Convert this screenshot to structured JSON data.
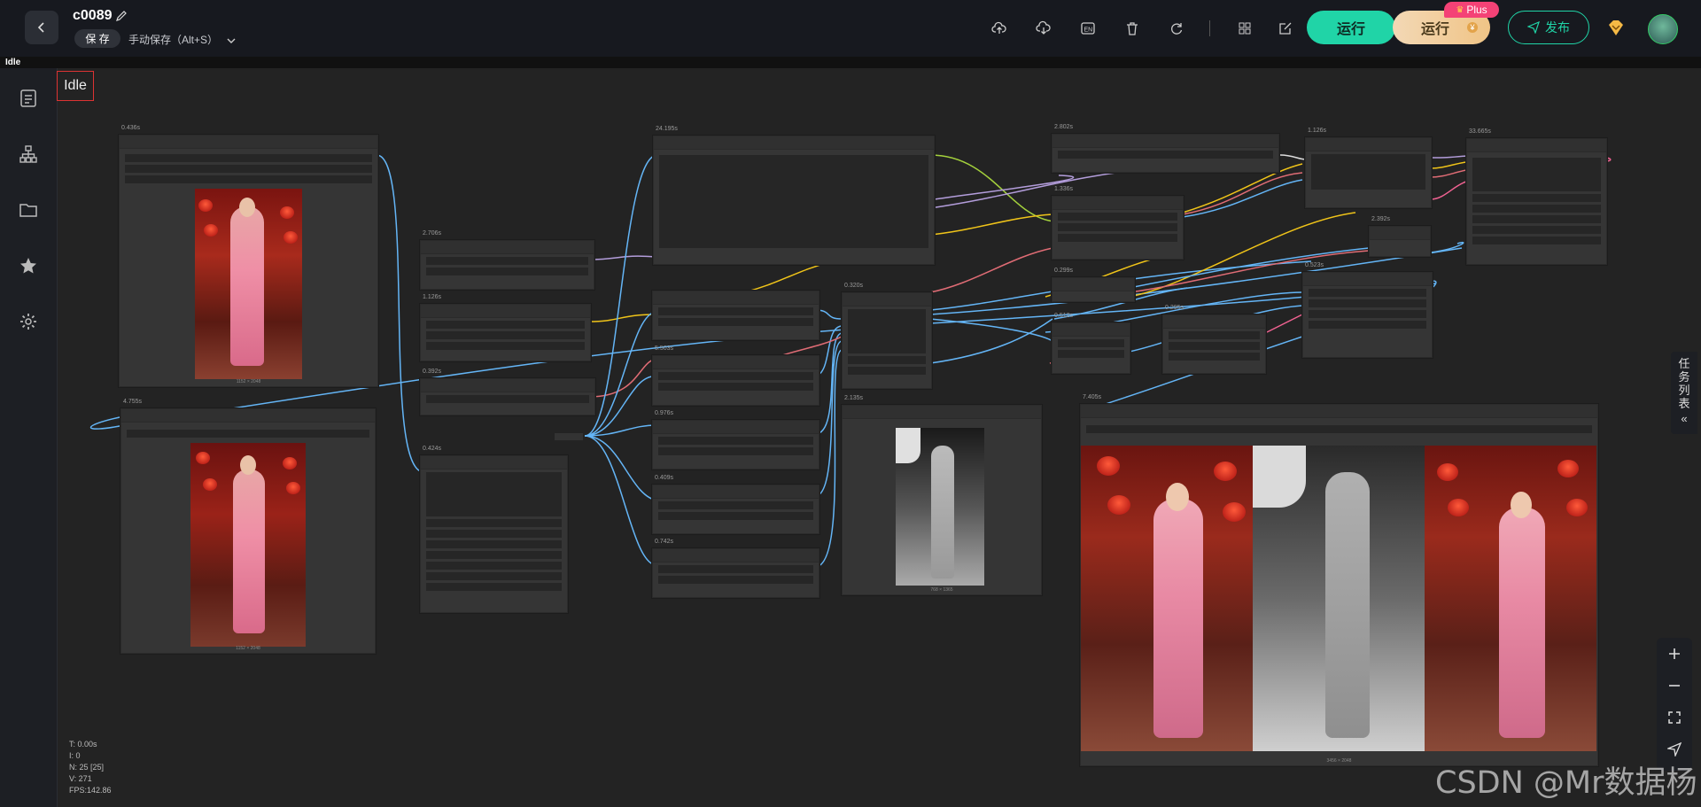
{
  "header": {
    "workflow_title": "c0089",
    "save_button": "保 存",
    "save_mode": "手动保存（Alt+S）",
    "run_button": "运行",
    "run_plus_button": "运行",
    "plus_badge": "Plus",
    "publish_button": "发布",
    "toolbar_icons": [
      "upload-icon",
      "download-icon",
      "en-icon",
      "delete-icon",
      "refresh-icon",
      "grid-icon",
      "edit-note-icon"
    ]
  },
  "status_strip": "Idle",
  "canvas": {
    "idle_label": "Idle",
    "node_times": [
      "0.436s",
      "4.755s",
      "2.706s",
      "1.126s",
      "0.392s",
      "0.424s",
      "24.195s",
      "5.503s",
      "0.976s",
      "0.409s",
      "0.742s",
      "0.320s",
      "2.135s",
      "2.802s",
      "1.336s",
      "0.299s",
      "0.512s",
      "0.295s",
      "1.126s",
      "2.392s",
      "0.523s",
      "33.665s",
      "7.405s"
    ],
    "image_sizes": [
      "1152 × 2048",
      "1152 × 2048",
      "768 × 1365",
      "3456 × 2048"
    ]
  },
  "stats": {
    "t": "T: 0.00s",
    "i": "I: 0",
    "n": "N: 25 [25]",
    "v": "V: 271",
    "fps": "FPS:142.86"
  },
  "right_panel": {
    "task_list": "任务列表"
  },
  "watermark": "CSDN @Mr数据杨",
  "colors": {
    "run": "#20d4a7",
    "plus_badge": "#f44276",
    "wire_blue": "#64b5f6",
    "wire_yellow": "#f0c419",
    "wire_pink": "#e06c75",
    "wire_purple": "#b39ddb"
  }
}
